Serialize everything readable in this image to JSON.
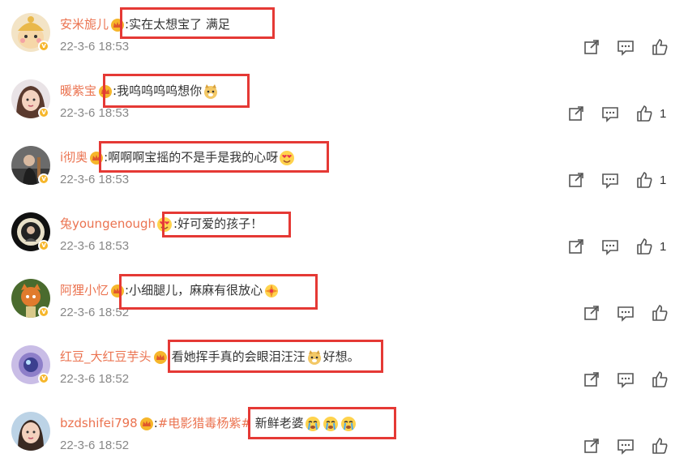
{
  "comments": [
    {
      "user": "安米旎儿",
      "sep": ":",
      "text": "实在太想宝了 满足",
      "time": "22-3-6 18:53",
      "likes": ""
    },
    {
      "user": "暖紫宝",
      "sep": ":",
      "text": "我呜呜呜呜想你",
      "time": "22-3-6 18:53",
      "likes": "1"
    },
    {
      "user": "i彻奥",
      "sep": ":",
      "text": "啊啊啊宝摇的不是手是我的心呀",
      "time": "22-3-6 18:53",
      "likes": "1"
    },
    {
      "user": "兔youngenough",
      "sep": ":",
      "text": "好可爱的孩子！",
      "time": "22-3-6 18:53",
      "likes": "1"
    },
    {
      "user": "阿狸小忆",
      "sep": ":",
      "text": "小细腿儿，麻麻有很放心",
      "time": "22-3-6 18:52",
      "likes": ""
    },
    {
      "user": "红豆_大红豆芋头",
      "sep": ":",
      "text": "看她挥手真的会眼泪汪汪",
      "text2": "好想。",
      "time": "22-3-6 18:52",
      "likes": ""
    },
    {
      "user": "bzdshifei798",
      "sep": ":",
      "hashtag": "#电影猎毒杨紫#",
      "text": " 新鲜老婆",
      "time": "22-3-6 18:52",
      "likes": ""
    }
  ],
  "icons": {
    "share": "share-icon",
    "comment": "comment-icon",
    "like": "thumbs-up-icon",
    "verified": "verified-badge-icon",
    "vip": "vip-crown-icon"
  },
  "colors": {
    "username": "#eb7350",
    "highlight": "#e53935",
    "verified": "#f6b62b",
    "time": "#888888"
  }
}
